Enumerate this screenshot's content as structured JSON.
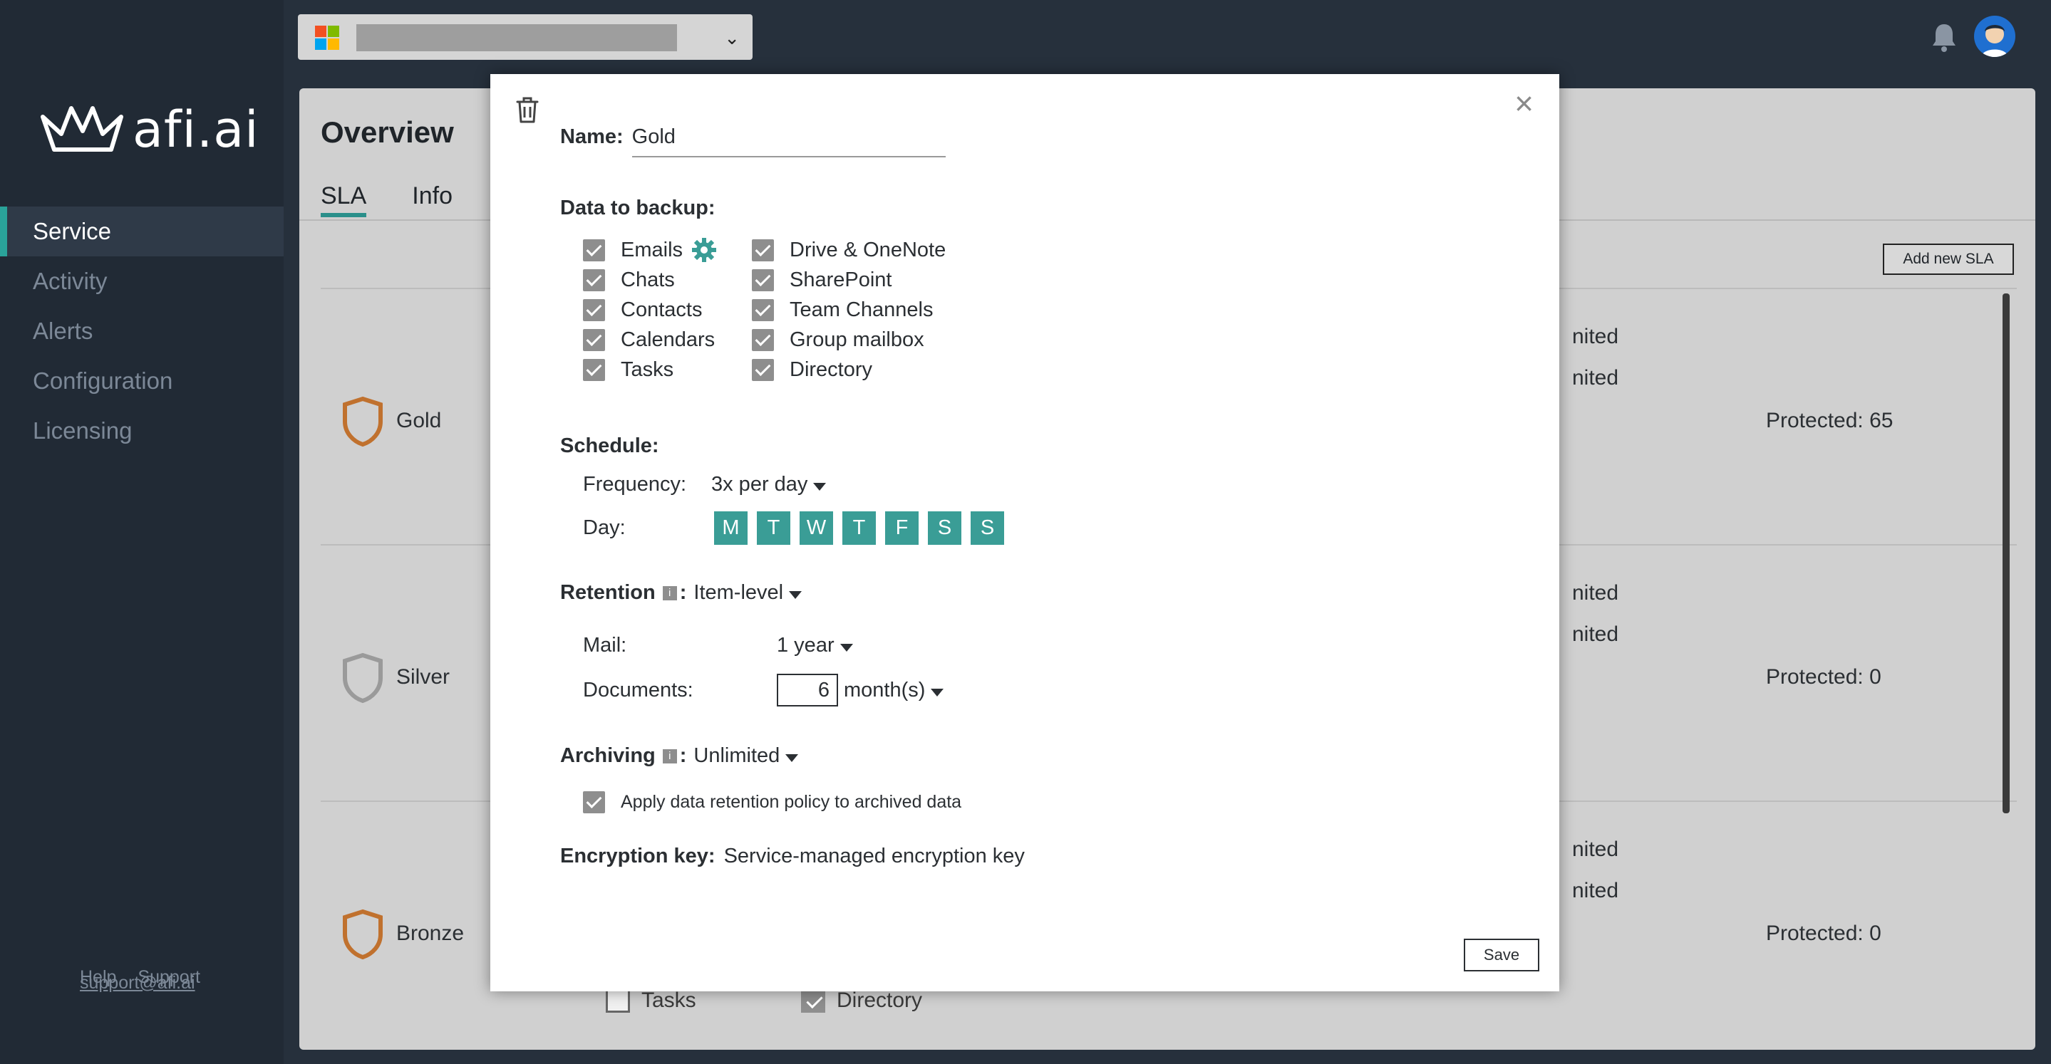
{
  "app": {
    "logo_text": "afi.ai",
    "brand_color": "#2aa39a"
  },
  "sidebar": {
    "items": [
      {
        "label": "Service",
        "active": true
      },
      {
        "label": "Activity"
      },
      {
        "label": "Alerts"
      },
      {
        "label": "Configuration"
      },
      {
        "label": "Licensing"
      }
    ],
    "footer": {
      "help": "Help",
      "support": "Support",
      "email": "support@afi.ai"
    }
  },
  "topbar": {
    "tenant_icon": "microsoft-logo-icon",
    "notification_icon": "bell-icon",
    "avatar_icon": "user-avatar-icon"
  },
  "overview": {
    "title": "Overview",
    "tabs": [
      "SLA",
      "Info"
    ],
    "add_button": "Add new SLA",
    "rows": [
      {
        "name": "Gold",
        "lim1": "nited",
        "lim2": "nited",
        "protected": "Protected: 65",
        "shield_color": "#c0712e"
      },
      {
        "name": "Silver",
        "lim1": "nited",
        "lim2": "nited",
        "protected": "Protected: 0",
        "shield_color": "#9a9a9a"
      },
      {
        "name": "Bronze",
        "lim1": "nited",
        "lim2": "nited",
        "protected": "Protected: 0",
        "shield_color": "#c0712e"
      }
    ],
    "peek": {
      "tasks": "Tasks",
      "directory": "Directory"
    }
  },
  "modal": {
    "name_label": "Name:",
    "name_value": "Gold",
    "backup_label": "Data to backup:",
    "backup_left": [
      "Emails",
      "Chats",
      "Contacts",
      "Calendars",
      "Tasks"
    ],
    "backup_right": [
      "Drive & OneNote",
      "SharePoint",
      "Team Channels",
      "Group mailbox",
      "Directory"
    ],
    "schedule_label": "Schedule:",
    "frequency_label": "Frequency:",
    "frequency_value": "3x per day",
    "day_label": "Day:",
    "days": [
      "M",
      "T",
      "W",
      "T",
      "F",
      "S",
      "S"
    ],
    "retention_label": "Retention",
    "retention_value": "Item-level",
    "mail_label": "Mail:",
    "mail_value": "1 year",
    "documents_label": "Documents:",
    "documents_value": "6",
    "documents_unit": "month(s)",
    "archiving_label": "Archiving",
    "archiving_value": "Unlimited",
    "apply_policy": "Apply data retention policy to archived data",
    "encryption_label": "Encryption key:",
    "encryption_value": "Service-managed encryption key",
    "save_label": "Save",
    "colon": ":"
  }
}
